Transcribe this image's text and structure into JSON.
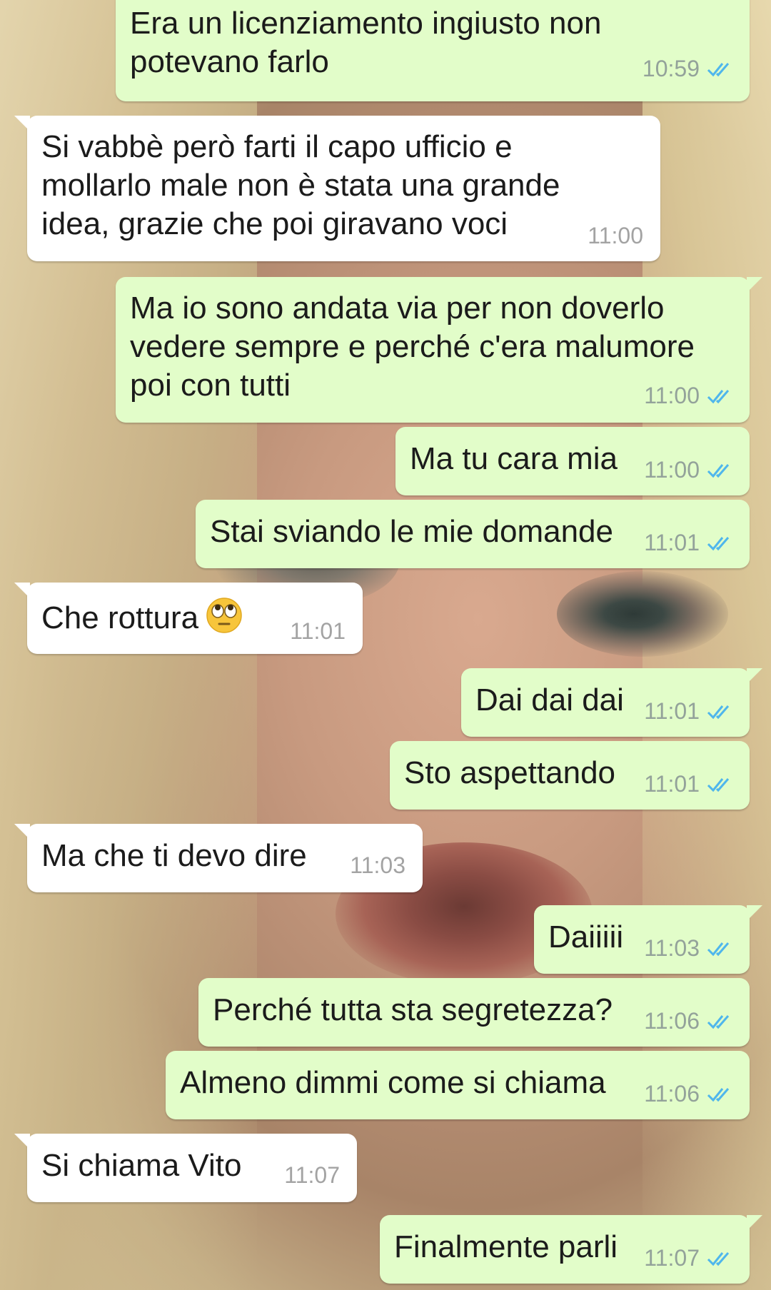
{
  "messages": [
    {
      "dir": "out",
      "text": "Era un licenziamento ingiusto non\npotevano farlo",
      "time": "10:59",
      "status": "read-ticks-icon"
    },
    {
      "dir": "in",
      "text": "Si vabbè però farti il capo ufficio e\nmollarlo male non è stata una grande\nidea, grazie che poi giravano voci",
      "time": "11:00"
    },
    {
      "dir": "out",
      "text": "Ma io sono andata via per non doverlo\nvedere sempre e perché c'era malumore\npoi con tutti",
      "time": "11:00",
      "status": "read-ticks-icon"
    },
    {
      "dir": "out",
      "text": "Ma tu cara mia",
      "time": "11:00",
      "status": "read-ticks-icon"
    },
    {
      "dir": "out",
      "text": "Stai sviando le mie domande",
      "time": "11:01",
      "status": "read-ticks-icon"
    },
    {
      "dir": "in",
      "text": "Che rottura",
      "emoji": "face-with-rolling-eyes-icon",
      "time": "11:01"
    },
    {
      "dir": "out",
      "text": "Dai dai dai",
      "time": "11:01",
      "status": "read-ticks-icon"
    },
    {
      "dir": "out",
      "text": "Sto aspettando",
      "time": "11:01",
      "status": "read-ticks-icon"
    },
    {
      "dir": "in",
      "text": "Ma che ti devo dire",
      "time": "11:03"
    },
    {
      "dir": "out",
      "text": "Daiiiii",
      "time": "11:03",
      "status": "read-ticks-icon"
    },
    {
      "dir": "out",
      "text": "Perché tutta sta segretezza?",
      "time": "11:06",
      "status": "read-ticks-icon"
    },
    {
      "dir": "out",
      "text": "Almeno dimmi come si chiama",
      "time": "11:06",
      "status": "read-ticks-icon"
    },
    {
      "dir": "in",
      "text": "Si chiama Vito",
      "time": "11:07"
    },
    {
      "dir": "out",
      "text": "Finalmente parli",
      "time": "11:07",
      "status": "read-ticks-icon"
    }
  ],
  "colors": {
    "outgoing_bubble": "#e2fdc9",
    "incoming_bubble": "#ffffff",
    "read_ticks": "#4fb6ec",
    "time_text": "#93a29a"
  }
}
